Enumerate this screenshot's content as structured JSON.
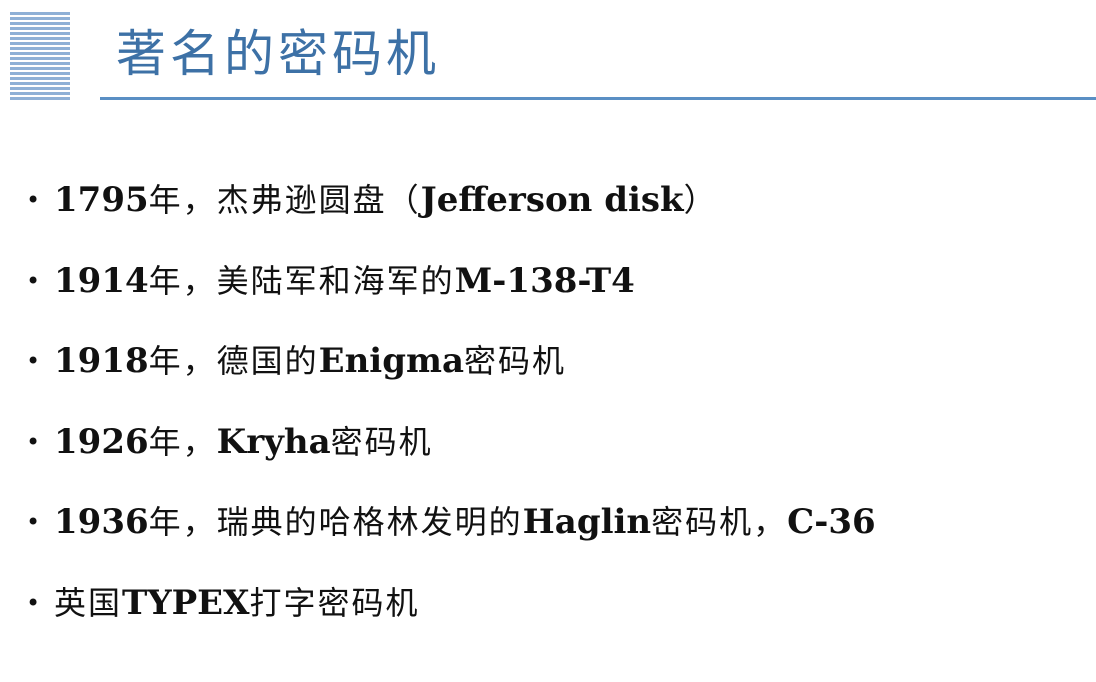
{
  "title": "著名的密码机",
  "bullet_symbol": "•",
  "items": [
    {
      "year": "1795",
      "year_suffix": "年，",
      "text1": "杰弗逊圆盘（",
      "bold1": "Jefferson disk",
      "text2": "）"
    },
    {
      "year": "1914",
      "year_suffix": "年，",
      "text1": "美陆军和海军的",
      "bold1": "M-138-T4"
    },
    {
      "year": "1918",
      "year_suffix": "年，",
      "text1": "德国的",
      "bold1": "Enigma",
      "text2": "密码机"
    },
    {
      "year": "1926",
      "year_suffix": "年，",
      "bold1": "Kryha",
      "text2": "密码机"
    },
    {
      "year": "1936",
      "year_suffix": "年，",
      "text1": "瑞典的哈格林发明的",
      "bold1": "Haglin",
      "text2": "密码机，",
      "bold2": "C-36"
    },
    {
      "text1": "英国",
      "bold1": "TYPEX",
      "text2": "打字密码机"
    }
  ]
}
